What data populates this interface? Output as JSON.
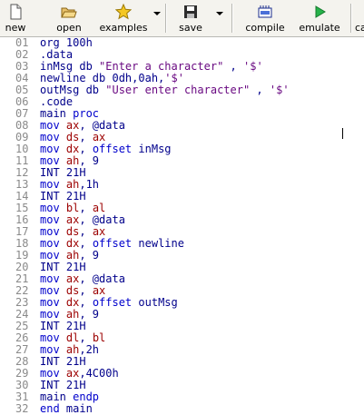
{
  "toolbar": {
    "new_label": "new",
    "open_label": "open",
    "examples_label": "examples",
    "save_label": "save",
    "compile_label": "compile",
    "emulate_label": "emulate",
    "calc_label": "ca",
    "icons": {
      "new": "new-file-icon",
      "open": "open-folder-icon",
      "examples": "star-icon",
      "save": "floppy-disk-icon",
      "compile": "compile-icon",
      "emulate": "play-icon"
    }
  },
  "editor": {
    "lines": [
      {
        "n": "01",
        "parts": [
          [
            "code",
            "org 100h"
          ]
        ]
      },
      {
        "n": "02",
        "parts": [
          [
            "code",
            ".data"
          ]
        ]
      },
      {
        "n": "03",
        "parts": [
          [
            "code",
            "inMsg db "
          ],
          [
            "str",
            "\"Enter a character\""
          ],
          [
            "code",
            " , "
          ],
          [
            "str",
            "'$'"
          ]
        ]
      },
      {
        "n": "04",
        "parts": [
          [
            "code",
            "newline db 0dh,0ah,"
          ],
          [
            "str",
            "'$'"
          ]
        ]
      },
      {
        "n": "05",
        "parts": [
          [
            "code",
            "outMsg db "
          ],
          [
            "str",
            "\"User enter character\""
          ],
          [
            "code",
            " , "
          ],
          [
            "str",
            "'$'"
          ]
        ]
      },
      {
        "n": "06",
        "parts": [
          [
            "code",
            ".code"
          ]
        ]
      },
      {
        "n": "07",
        "parts": [
          [
            "code",
            "main "
          ],
          [
            "kw",
            "proc"
          ]
        ]
      },
      {
        "n": "08",
        "parts": [
          [
            "kw",
            "mov "
          ],
          [
            "reg",
            "ax"
          ],
          [
            "code",
            ", @data"
          ]
        ]
      },
      {
        "n": "09",
        "parts": [
          [
            "kw",
            "mov "
          ],
          [
            "reg",
            "ds"
          ],
          [
            "code",
            ", "
          ],
          [
            "reg",
            "ax"
          ]
        ]
      },
      {
        "n": "10",
        "parts": [
          [
            "kw",
            "mov "
          ],
          [
            "reg",
            "dx"
          ],
          [
            "code",
            ", "
          ],
          [
            "kw",
            "offset"
          ],
          [
            "code",
            " inMsg"
          ]
        ]
      },
      {
        "n": "11",
        "parts": [
          [
            "kw",
            "mov "
          ],
          [
            "reg",
            "ah"
          ],
          [
            "code",
            ", 9"
          ]
        ]
      },
      {
        "n": "12",
        "parts": [
          [
            "code",
            "INT 21H"
          ]
        ]
      },
      {
        "n": "13",
        "parts": [
          [
            "kw",
            "mov "
          ],
          [
            "reg",
            "ah"
          ],
          [
            "code",
            ",1h"
          ]
        ]
      },
      {
        "n": "14",
        "parts": [
          [
            "code",
            "INT 21H"
          ]
        ]
      },
      {
        "n": "15",
        "parts": [
          [
            "kw",
            "mov "
          ],
          [
            "reg",
            "bl"
          ],
          [
            "code",
            ", "
          ],
          [
            "reg",
            "al"
          ]
        ]
      },
      {
        "n": "16",
        "parts": [
          [
            "kw",
            "mov "
          ],
          [
            "reg",
            "ax"
          ],
          [
            "code",
            ", @data"
          ]
        ]
      },
      {
        "n": "17",
        "parts": [
          [
            "kw",
            "mov "
          ],
          [
            "reg",
            "ds"
          ],
          [
            "code",
            ", "
          ],
          [
            "reg",
            "ax"
          ]
        ]
      },
      {
        "n": "18",
        "parts": [
          [
            "kw",
            "mov "
          ],
          [
            "reg",
            "dx"
          ],
          [
            "code",
            ", "
          ],
          [
            "kw",
            "offset"
          ],
          [
            "code",
            " newline"
          ]
        ]
      },
      {
        "n": "19",
        "parts": [
          [
            "kw",
            "mov "
          ],
          [
            "reg",
            "ah"
          ],
          [
            "code",
            ", 9"
          ]
        ]
      },
      {
        "n": "20",
        "parts": [
          [
            "code",
            "INT 21H"
          ]
        ]
      },
      {
        "n": "21",
        "parts": [
          [
            "kw",
            "mov "
          ],
          [
            "reg",
            "ax"
          ],
          [
            "code",
            ", @data"
          ]
        ]
      },
      {
        "n": "22",
        "parts": [
          [
            "kw",
            "mov "
          ],
          [
            "reg",
            "ds"
          ],
          [
            "code",
            ", "
          ],
          [
            "reg",
            "ax"
          ]
        ]
      },
      {
        "n": "23",
        "parts": [
          [
            "kw",
            "mov "
          ],
          [
            "reg",
            "dx"
          ],
          [
            "code",
            ", "
          ],
          [
            "kw",
            "offset"
          ],
          [
            "code",
            " outMsg"
          ]
        ]
      },
      {
        "n": "24",
        "parts": [
          [
            "kw",
            "mov "
          ],
          [
            "reg",
            "ah"
          ],
          [
            "code",
            ", 9"
          ]
        ]
      },
      {
        "n": "25",
        "parts": [
          [
            "code",
            "INT 21H"
          ]
        ]
      },
      {
        "n": "26",
        "parts": [
          [
            "kw",
            "mov "
          ],
          [
            "reg",
            "dl"
          ],
          [
            "code",
            ", "
          ],
          [
            "reg",
            "bl"
          ]
        ]
      },
      {
        "n": "27",
        "parts": [
          [
            "kw",
            "mov "
          ],
          [
            "reg",
            "ah"
          ],
          [
            "code",
            ",2h"
          ]
        ]
      },
      {
        "n": "28",
        "parts": [
          [
            "code",
            "INT 21H"
          ]
        ]
      },
      {
        "n": "29",
        "parts": [
          [
            "kw",
            "mov "
          ],
          [
            "reg",
            "ax"
          ],
          [
            "code",
            ",4C00h"
          ]
        ]
      },
      {
        "n": "30",
        "parts": [
          [
            "code",
            "INT 21H"
          ]
        ]
      },
      {
        "n": "31",
        "parts": [
          [
            "code",
            "main "
          ],
          [
            "kw",
            "endp"
          ]
        ]
      },
      {
        "n": "32",
        "parts": [
          [
            "kw",
            "end"
          ],
          [
            "code",
            " main"
          ]
        ]
      }
    ]
  },
  "colors": {
    "code": "#00008b",
    "keyword": "#0000cc",
    "register": "#9c0000",
    "string": "#6a0a82",
    "line_number": "#8a8a8a"
  }
}
